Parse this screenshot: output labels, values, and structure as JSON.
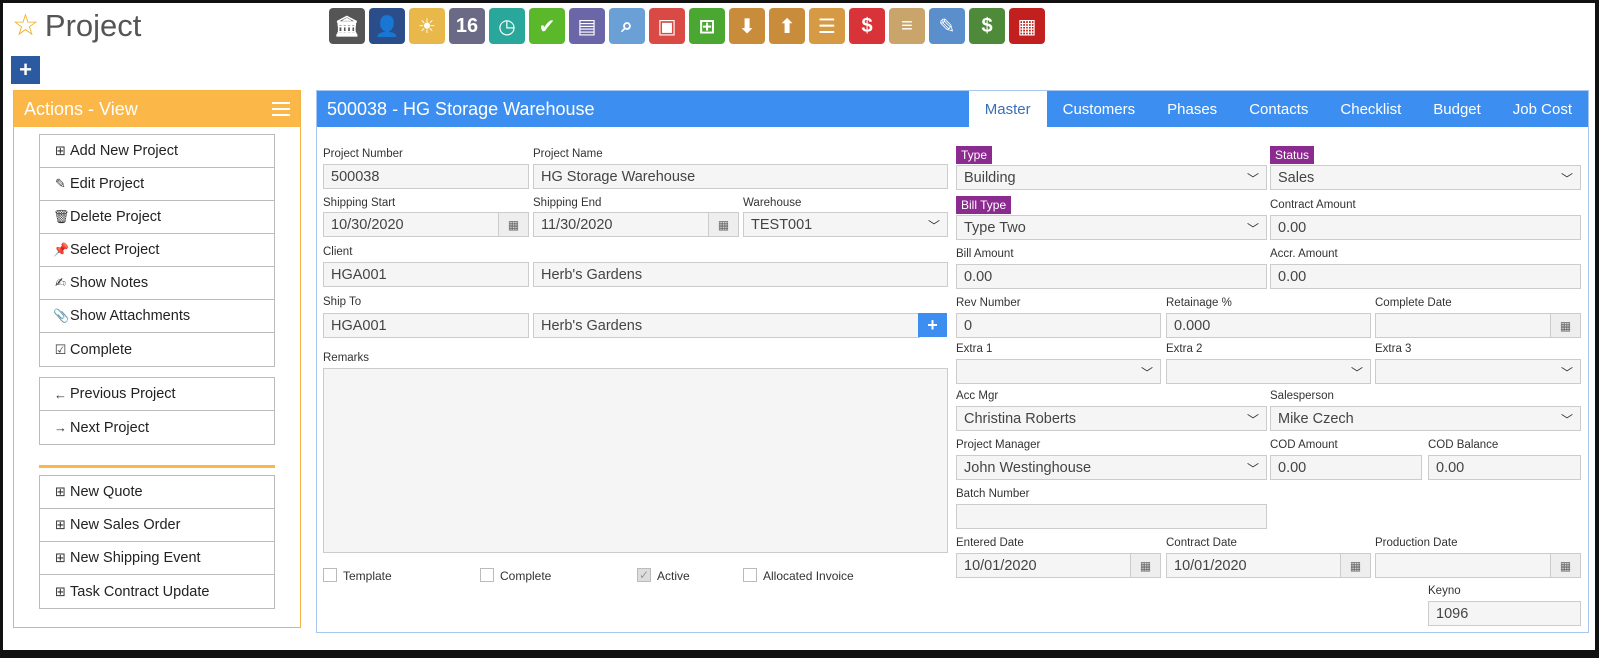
{
  "page": {
    "title": "Project"
  },
  "toolbar": {
    "icons": [
      {
        "name": "bank-icon",
        "color": "#555"
      },
      {
        "name": "person-icon",
        "color": "#2b4d8a"
      },
      {
        "name": "weather-icon",
        "color": "#e8b94a"
      },
      {
        "name": "calendar-icon",
        "label": "16",
        "color": "#6b6a86"
      },
      {
        "name": "clock-icon",
        "color": "#2aa79b"
      },
      {
        "name": "checkmark-icon",
        "color": "#5cb82b"
      },
      {
        "name": "list-window-icon",
        "color": "#6a66a8"
      },
      {
        "name": "magnifier-icon",
        "color": "#6aa0d6"
      },
      {
        "name": "truck-icon",
        "color": "#d94a44"
      },
      {
        "name": "basket-icon",
        "color": "#4aa832"
      },
      {
        "name": "inbox-download-icon",
        "color": "#c88c3a"
      },
      {
        "name": "box-upload-icon",
        "color": "#c88c3a"
      },
      {
        "name": "hand-card-icon",
        "color": "#d69a44"
      },
      {
        "name": "price-bubble-icon",
        "color": "#d9333a"
      },
      {
        "name": "document-list-icon",
        "color": "#c9a46b"
      },
      {
        "name": "eraser-icon",
        "color": "#5a8fcc"
      },
      {
        "name": "money-icon",
        "color": "#4f8a3a"
      },
      {
        "name": "building-icon",
        "color": "#c21f1f"
      }
    ]
  },
  "actions": {
    "header": "Actions - View",
    "group1": [
      {
        "label": "Add New Project",
        "icon": "plus-square-icon",
        "glyph": "⊞"
      },
      {
        "label": "Edit Project",
        "icon": "pencil-icon",
        "glyph": "✎"
      },
      {
        "label": "Delete Project",
        "icon": "trash-icon",
        "glyph": "🗑"
      },
      {
        "label": "Select Project",
        "icon": "pin-icon",
        "glyph": "📌"
      },
      {
        "label": "Show Notes",
        "icon": "note-edit-icon",
        "glyph": "✍"
      },
      {
        "label": "Show Attachments",
        "icon": "paperclip-icon",
        "glyph": "📎"
      },
      {
        "label": "Complete",
        "icon": "check-square-icon",
        "glyph": "☑"
      }
    ],
    "group2": [
      {
        "label": "Previous Project",
        "icon": "arrow-left-icon",
        "glyph": "←"
      },
      {
        "label": "Next Project",
        "icon": "arrow-right-icon",
        "glyph": "→"
      }
    ],
    "group3": [
      {
        "label": "New Quote",
        "icon": "plus-square-icon",
        "glyph": "⊞"
      },
      {
        "label": "New Sales Order",
        "icon": "plus-square-icon",
        "glyph": "⊞"
      },
      {
        "label": "New Shipping Event",
        "icon": "plus-square-icon",
        "glyph": "⊞"
      },
      {
        "label": "Task Contract Update",
        "icon": "plus-square-icon",
        "glyph": "⊞"
      }
    ]
  },
  "main": {
    "title": "500038 - HG Storage Warehouse",
    "tabs": [
      "Master",
      "Customers",
      "Phases",
      "Contacts",
      "Checklist",
      "Budget",
      "Job Cost"
    ],
    "active_tab": "Master"
  },
  "form": {
    "project_number": {
      "label": "Project Number",
      "value": "500038"
    },
    "project_name": {
      "label": "Project Name",
      "value": "HG Storage Warehouse"
    },
    "shipping_start": {
      "label": "Shipping Start",
      "value": "10/30/2020"
    },
    "shipping_end": {
      "label": "Shipping End",
      "value": "11/30/2020"
    },
    "warehouse": {
      "label": "Warehouse",
      "value": "TEST001"
    },
    "client": {
      "label": "Client",
      "code": "HGA001",
      "name": "Herb's Gardens"
    },
    "ship_to": {
      "label": "Ship To",
      "code": "HGA001",
      "name": "Herb's Gardens"
    },
    "remarks": {
      "label": "Remarks",
      "value": ""
    },
    "checkboxes": [
      {
        "label": "Template",
        "checked": false
      },
      {
        "label": "Complete",
        "checked": false
      },
      {
        "label": "Active",
        "checked": true
      },
      {
        "label": "Allocated Invoice",
        "checked": false
      }
    ],
    "type": {
      "label": "Type",
      "value": "Building"
    },
    "status": {
      "label": "Status",
      "value": "Sales"
    },
    "bill_type": {
      "label": "Bill Type",
      "value": "Type Two"
    },
    "contract_amount": {
      "label": "Contract Amount",
      "value": "0.00"
    },
    "bill_amount": {
      "label": "Bill Amount",
      "value": "0.00"
    },
    "accr_amount": {
      "label": "Accr. Amount",
      "value": "0.00"
    },
    "rev_number": {
      "label": "Rev Number",
      "value": "0"
    },
    "retainage": {
      "label": "Retainage %",
      "value": "0.000"
    },
    "complete_date": {
      "label": "Complete Date",
      "value": " /  /"
    },
    "extra1": {
      "label": "Extra 1",
      "value": ""
    },
    "extra2": {
      "label": "Extra 2",
      "value": ""
    },
    "extra3": {
      "label": "Extra 3",
      "value": ""
    },
    "acc_mgr": {
      "label": "Acc Mgr",
      "value": "Christina Roberts"
    },
    "salesperson": {
      "label": "Salesperson",
      "value": "Mike Czech"
    },
    "project_manager": {
      "label": "Project Manager",
      "value": "John Westinghouse"
    },
    "cod_amount": {
      "label": "COD Amount",
      "value": "0.00"
    },
    "cod_balance": {
      "label": "COD Balance",
      "value": "0.00"
    },
    "batch_number": {
      "label": "Batch Number",
      "value": ""
    },
    "entered_date": {
      "label": "Entered Date",
      "value": "10/01/2020"
    },
    "contract_date": {
      "label": "Contract Date",
      "value": "10/01/2020"
    },
    "production_date": {
      "label": "Production Date",
      "value": " /  /"
    },
    "keyno": {
      "label": "Keyno",
      "value": "1096"
    }
  },
  "colors": {
    "accent_orange": "#fbb747",
    "header_blue": "#3c8ff0",
    "pill_purple": "#8b2a8f",
    "plus_blue": "#2c5aa0"
  }
}
